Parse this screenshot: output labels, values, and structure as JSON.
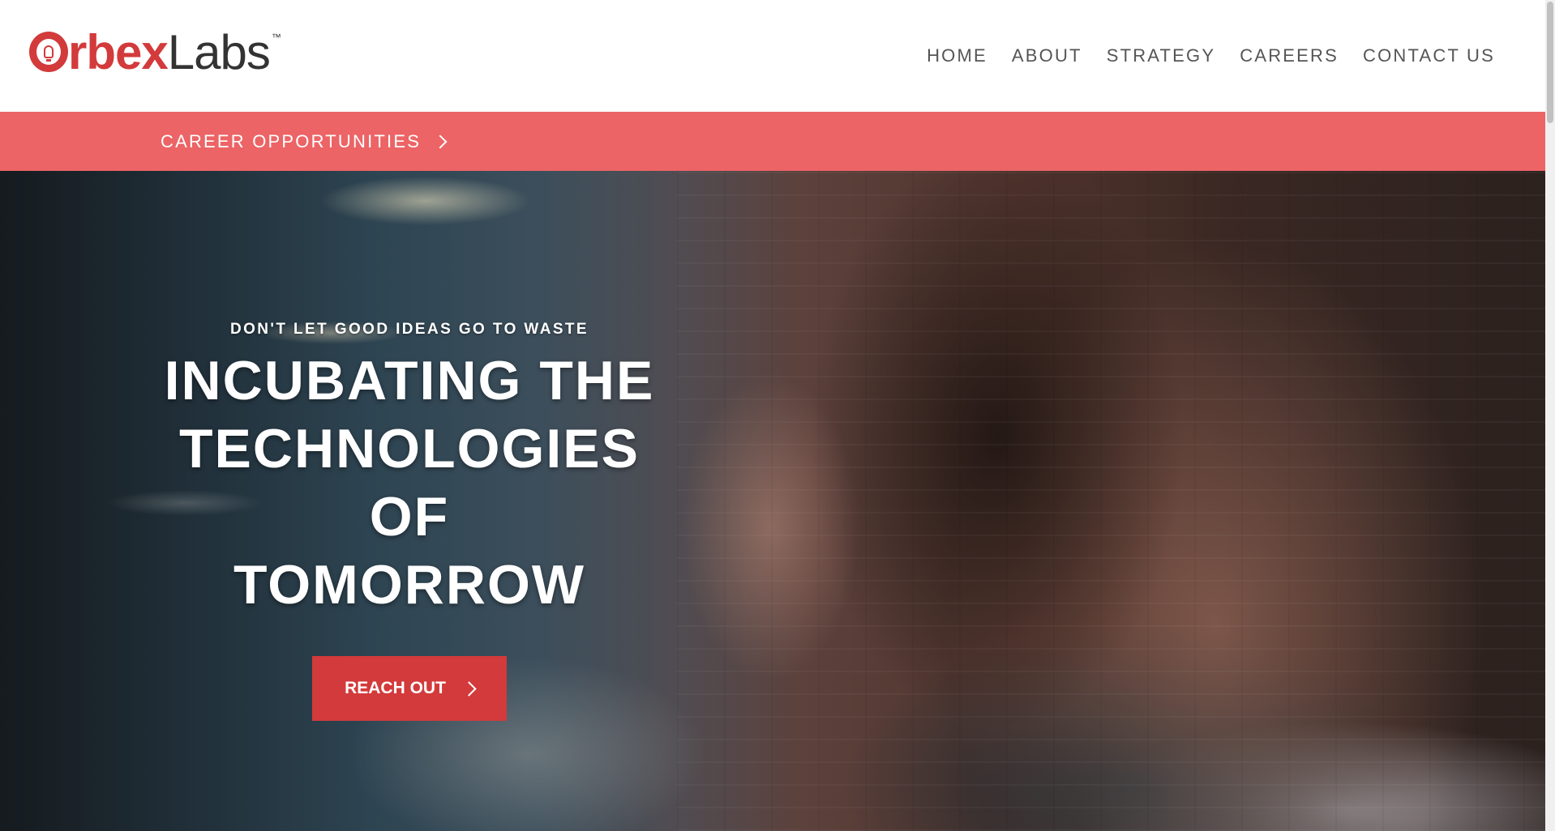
{
  "brand": {
    "logo_o": "O",
    "logo_bold": "rbex",
    "logo_light": "Labs",
    "logo_tm": "™",
    "accent_color": "#d33a3b",
    "strip_color": "#ec6466"
  },
  "nav": {
    "items": [
      {
        "label": "HOME"
      },
      {
        "label": "ABOUT"
      },
      {
        "label": "STRATEGY"
      },
      {
        "label": "CAREERS"
      },
      {
        "label": "CONTACT US"
      }
    ]
  },
  "strip": {
    "label": "CAREER OPPORTUNITIES",
    "icon": "chevron-right-icon"
  },
  "hero": {
    "eyebrow": "DON'T LET GOOD IDEAS GO TO WASTE",
    "headline_line1": "INCUBATING THE",
    "headline_line2": "TECHNOLOGIES OF",
    "headline_line3": "TOMORROW",
    "cta_label": "REACH OUT",
    "cta_icon": "chevron-right-icon"
  }
}
